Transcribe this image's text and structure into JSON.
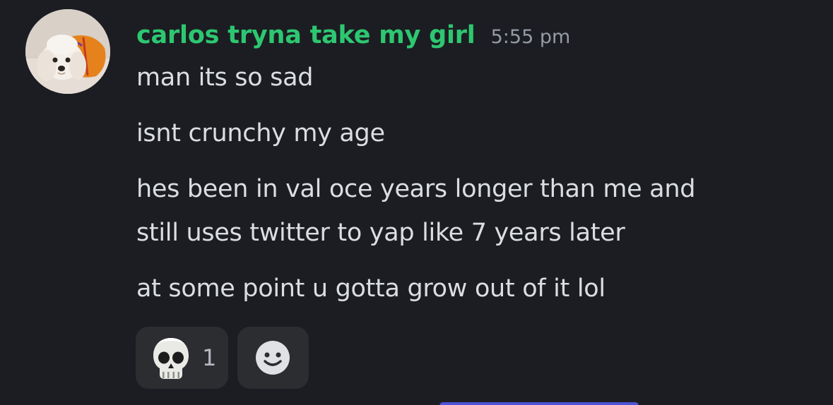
{
  "message": {
    "username": "carlos tryna take my girl",
    "timestamp": "5:55 pm",
    "lines": [
      "man its so sad",
      "isnt crunchy my age",
      "hes been in val oce years longer than me and",
      "still uses twitter to yap like 7 years later",
      "at some point u gotta grow out of it lol"
    ]
  },
  "reactions": [
    {
      "emoji": "skull-emoji",
      "count": "1"
    }
  ],
  "add_reaction_icon": "smiley-add-reaction-icon",
  "colors": {
    "background": "#1c1d22",
    "username": "#2dc771",
    "timestamp": "#949ba4",
    "message_text": "#dbdee1",
    "reaction_bg": "#2b2d31",
    "accent_bar": "#4c55d6"
  }
}
